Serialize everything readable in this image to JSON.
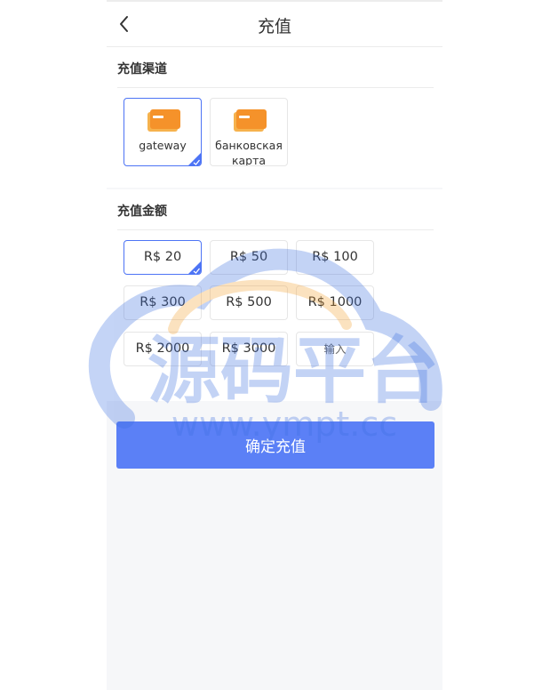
{
  "header": {
    "title": "充值"
  },
  "channel_section": {
    "title": "充值渠道",
    "items": [
      {
        "label": "gateway",
        "selected": true,
        "icon": "card-icon"
      },
      {
        "label": "банковская карта",
        "selected": false,
        "icon": "card-icon"
      }
    ]
  },
  "amount_section": {
    "title": "充值金额",
    "options": [
      {
        "label": "R$ 20",
        "selected": true
      },
      {
        "label": "R$ 50",
        "selected": false
      },
      {
        "label": "R$ 100",
        "selected": false
      },
      {
        "label": "R$ 300",
        "selected": false
      },
      {
        "label": "R$ 500",
        "selected": false
      },
      {
        "label": "R$ 1000",
        "selected": false
      },
      {
        "label": "R$ 2000",
        "selected": false
      },
      {
        "label": "R$ 3000",
        "selected": false
      }
    ],
    "custom_input": {
      "placeholder": "输入",
      "value": ""
    }
  },
  "submit": {
    "label": "确定充值"
  },
  "watermark": {
    "text": "源码平台",
    "url": "www.ympt.cc"
  },
  "colors": {
    "accent": "#4d74f5",
    "button": "#5b80f6",
    "card_orange": "#f5a623",
    "page_bg": "#f6f7f9"
  }
}
